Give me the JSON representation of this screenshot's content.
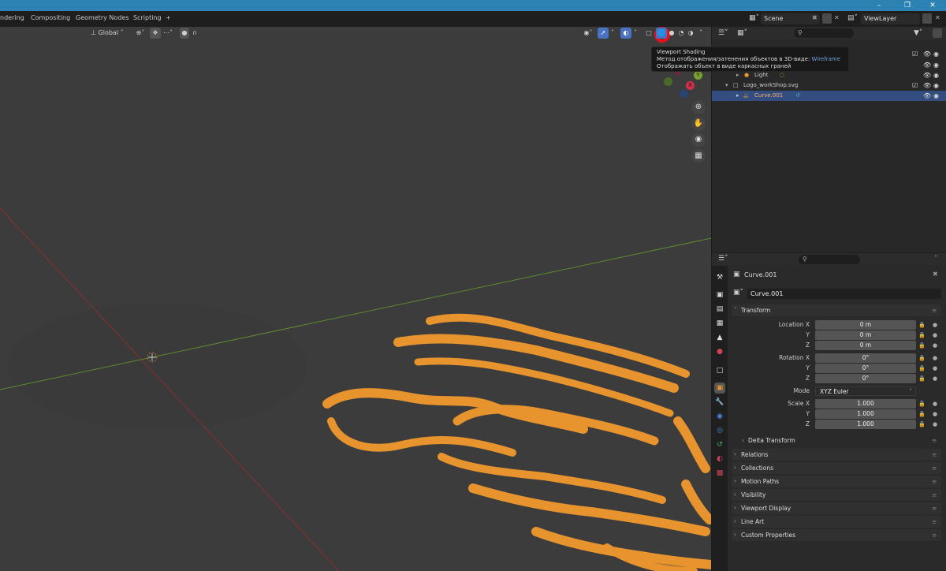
{
  "menubar": {
    "tabs": [
      "ndering",
      "Compositing",
      "Geometry Nodes",
      "Scripting",
      "+"
    ],
    "scene_name": "Scene",
    "view_layer": "ViewLayer"
  },
  "viewport": {
    "transform_orientation": "Global",
    "gizmo_axes": {
      "y": "Y",
      "x": "X"
    }
  },
  "tooltip": {
    "title": "Viewport Shading",
    "line1": "Метод отображения/затенения объектов в 3D-виде:",
    "mode": "Wireframe",
    "line2": "Отображать объект в виде каркасных граней"
  },
  "outliner": {
    "rows": [
      {
        "name": "Light"
      },
      {
        "name": "Logo_workShop.svg"
      },
      {
        "name": "Curve.001",
        "selected": true
      }
    ]
  },
  "properties": {
    "object_name": "Curve.001",
    "data_name": "Curve.001",
    "transform_title": "Transform",
    "location_label": "Location X",
    "rotation_label": "Rotation X",
    "scale_label": "Scale X",
    "y_label": "Y",
    "z_label": "Z",
    "mode_label": "Mode",
    "location": [
      "0 m",
      "0 m",
      "0 m"
    ],
    "rotation": [
      "0°",
      "0°",
      "0°"
    ],
    "rotation_mode": "XYZ Euler",
    "scale": [
      "1.000",
      "1.000",
      "1.000"
    ],
    "delta_transform": "Delta Transform",
    "panels": [
      "Relations",
      "Collections",
      "Motion Paths",
      "Visibility",
      "Viewport Display",
      "Line Art",
      "Custom Properties"
    ]
  },
  "colors": {
    "viewport_bg": "#3c3c3c",
    "selection": "#334d80",
    "object_orange": "#ff9a1f",
    "wire_orange": "#e7932e",
    "titlebar": "#2b82b3"
  }
}
